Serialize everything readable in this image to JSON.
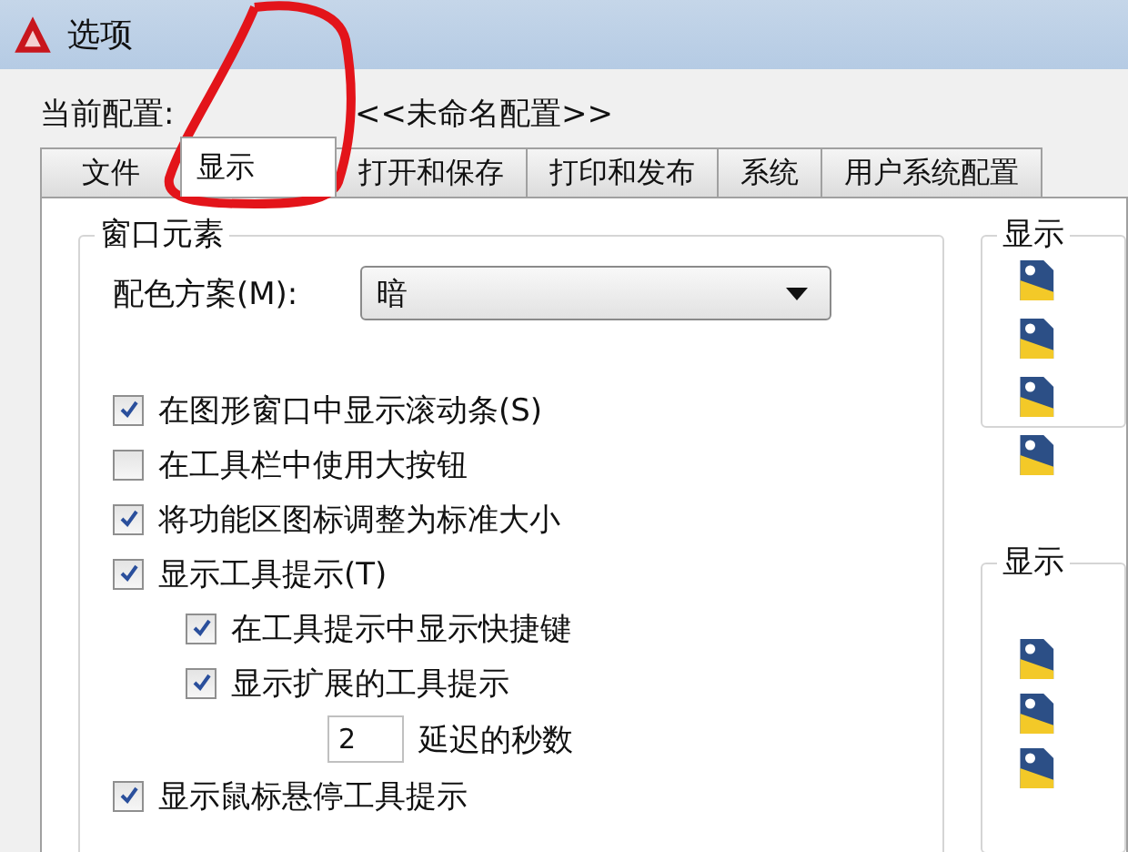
{
  "window": {
    "title": "选项"
  },
  "current_profile": {
    "label": "当前配置:",
    "value": "<<未命名配置>>"
  },
  "tabs": [
    {
      "label": "文件",
      "selected": false
    },
    {
      "label": "显示",
      "selected": true
    },
    {
      "label": "打开和保存",
      "selected": false
    },
    {
      "label": "打印和发布",
      "selected": false
    },
    {
      "label": "系统",
      "selected": false
    },
    {
      "label": "用户系统配置",
      "selected": false
    }
  ],
  "window_elements": {
    "title": "窗口元素",
    "color_scheme": {
      "label": "配色方案(M):",
      "value": "暗"
    },
    "options": [
      {
        "kind": "checkbox",
        "label": "在图形窗口中显示滚动条(S)",
        "checked": true
      },
      {
        "kind": "checkbox",
        "label": "在工具栏中使用大按钮",
        "checked": false
      },
      {
        "kind": "checkbox",
        "label": "将功能区图标调整为标准大小",
        "checked": true
      },
      {
        "kind": "checkbox",
        "label": "显示工具提示(T)",
        "checked": true,
        "children": [
          {
            "kind": "checkbox",
            "label": "在工具提示中显示快捷键",
            "checked": true
          },
          {
            "kind": "checkbox",
            "label": "显示扩展的工具提示",
            "checked": true,
            "children": [
              {
                "kind": "number",
                "value": "2",
                "label": "延迟的秒数"
              }
            ]
          }
        ]
      },
      {
        "kind": "checkbox",
        "label": "显示鼠标悬停工具提示",
        "checked": true
      }
    ]
  },
  "side_groups": [
    {
      "title": "显示"
    },
    {
      "title": "显示"
    }
  ]
}
